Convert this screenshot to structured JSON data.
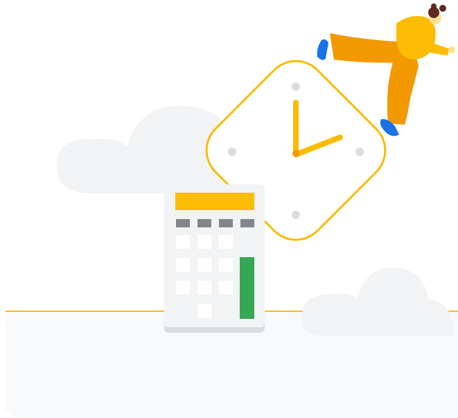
{
  "illustration": {
    "elements": [
      "clouds",
      "clock",
      "calculator",
      "person"
    ],
    "colors": {
      "accent_yellow": "#FBBC04",
      "accent_orange": "#F29900",
      "accent_green": "#34A853",
      "accent_blue": "#1A73E8",
      "cloud_gray": "#F1F3F4",
      "ground_gray": "#F8F9FA",
      "button_gray": "#80868B"
    },
    "clock_time_shown": "3:00"
  }
}
